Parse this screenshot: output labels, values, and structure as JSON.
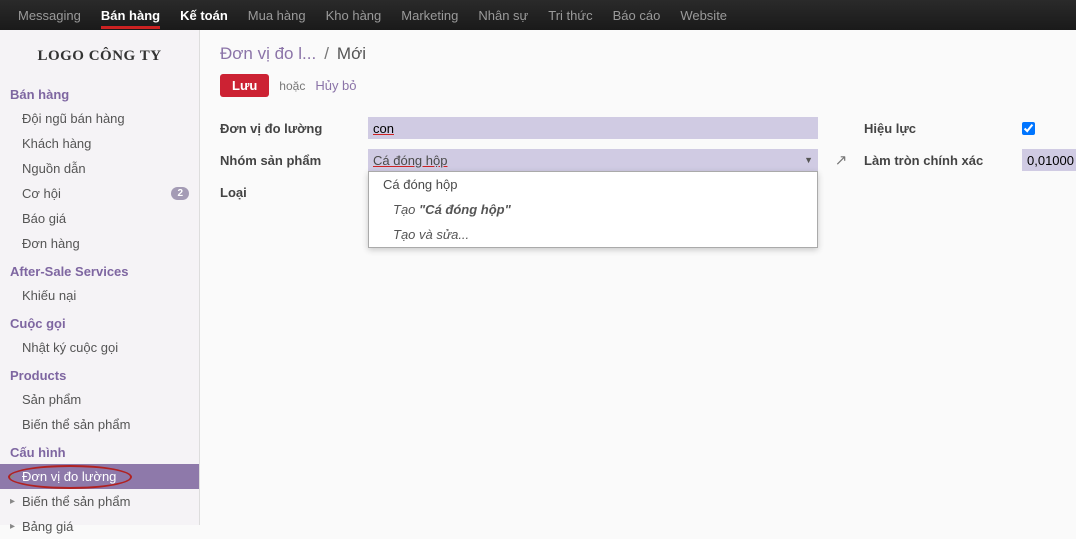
{
  "topnav": {
    "items": [
      {
        "label": "Messaging",
        "active": false
      },
      {
        "label": "Bán hàng",
        "active": true,
        "redline": true
      },
      {
        "label": "Kế toán",
        "active": true
      },
      {
        "label": "Mua hàng",
        "active": false
      },
      {
        "label": "Kho hàng",
        "active": false
      },
      {
        "label": "Marketing",
        "active": false
      },
      {
        "label": "Nhân sự",
        "active": false
      },
      {
        "label": "Tri thức",
        "active": false
      },
      {
        "label": "Báo cáo",
        "active": false
      },
      {
        "label": "Website",
        "active": false
      }
    ]
  },
  "logo_text": "LOGO CÔNG TY",
  "sidebar": {
    "sections": [
      {
        "title": "Bán hàng",
        "items": [
          {
            "label": "Đội ngũ bán hàng"
          },
          {
            "label": "Khách hàng"
          },
          {
            "label": "Nguồn dẫn"
          },
          {
            "label": "Cơ hội",
            "badge": "2"
          },
          {
            "label": "Báo giá"
          },
          {
            "label": "Đơn hàng"
          }
        ]
      },
      {
        "title": "After-Sale Services",
        "items": [
          {
            "label": "Khiếu nại"
          }
        ]
      },
      {
        "title": "Cuộc gọi",
        "items": [
          {
            "label": "Nhật ký cuộc gọi"
          }
        ]
      },
      {
        "title": "Products",
        "items": [
          {
            "label": "Sản phẩm"
          },
          {
            "label": "Biến thể sản phẩm"
          }
        ]
      },
      {
        "title": "Cấu hình",
        "items": [
          {
            "label": "Đơn vị đo lường",
            "active": true,
            "expandable": true,
            "circled": true
          },
          {
            "label": "Biến thể sản phẩm",
            "expandable": true
          },
          {
            "label": "Bảng giá",
            "expandable": true
          }
        ]
      }
    ]
  },
  "breadcrumbs": {
    "parent": "Đơn vị đo l...",
    "sep": "/",
    "current": "Mới"
  },
  "actions": {
    "save": "Lưu",
    "or": "hoặc",
    "discard": "Hủy bỏ"
  },
  "form": {
    "uom_label": "Đơn vị đo lường",
    "uom_value": "con",
    "group_label": "Nhóm sản phẩm",
    "group_value": "Cá đóng hộp",
    "type_label": "Loại",
    "active_label": "Hiệu lực",
    "active_checked": true,
    "rounding_label": "Làm tròn chính xác",
    "rounding_value": "0,01000"
  },
  "dropdown": {
    "option1": "Cá đóng hộp",
    "create_prefix": "Tạo ",
    "create_value": "\"Cá đóng hộp\"",
    "create_edit": "Tạo và sửa..."
  }
}
